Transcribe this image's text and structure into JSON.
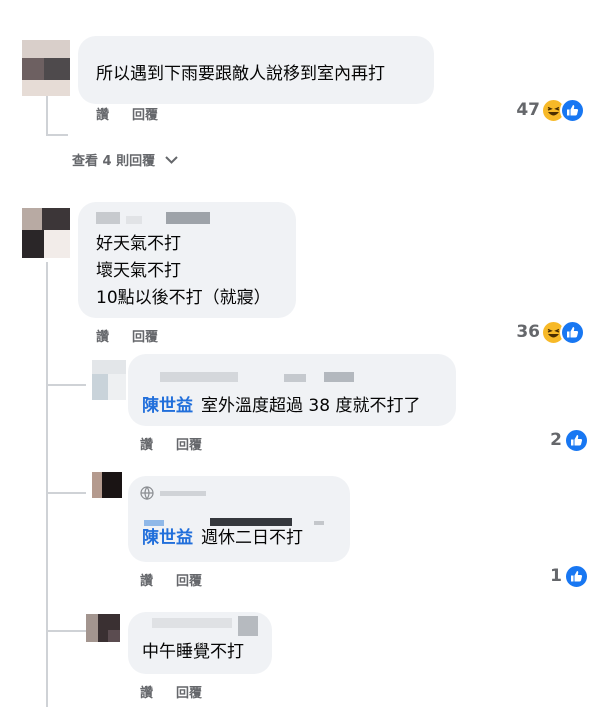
{
  "comments": [
    {
      "text": "所以遇到下雨要跟敵人說移到室內再打",
      "like_label": "讚",
      "reply_label": "回覆",
      "reaction_count": "47",
      "reactions": [
        "haha-icon",
        "like-icon"
      ],
      "view_replies_label": "查看 4 則回覆"
    },
    {
      "lines": [
        "好天氣不打",
        "壞天氣不打",
        "10點以後不打（就寢）"
      ],
      "like_label": "讚",
      "reply_label": "回覆",
      "reaction_count": "36",
      "reactions": [
        "haha-icon",
        "like-icon"
      ],
      "replies": [
        {
          "mention": "陳世益",
          "text": "室外溫度超過 38 度就不打了",
          "like_label": "讚",
          "reply_label": "回覆",
          "reaction_count": "2",
          "reactions": [
            "like-icon"
          ]
        },
        {
          "mention": "陳世益",
          "text": "週休二日不打",
          "like_label": "讚",
          "reply_label": "回覆",
          "reaction_count": "1",
          "reactions": [
            "like-icon"
          ]
        },
        {
          "mention": "",
          "text": "中午睡覺不打",
          "like_label": "讚",
          "reply_label": "回覆"
        }
      ]
    }
  ],
  "colors": {
    "bubble": "#f0f2f5",
    "mention": "#216fdb",
    "meta": "#65676b",
    "like_blue": "#1877f2",
    "haha_yellow": "#f7b928"
  }
}
